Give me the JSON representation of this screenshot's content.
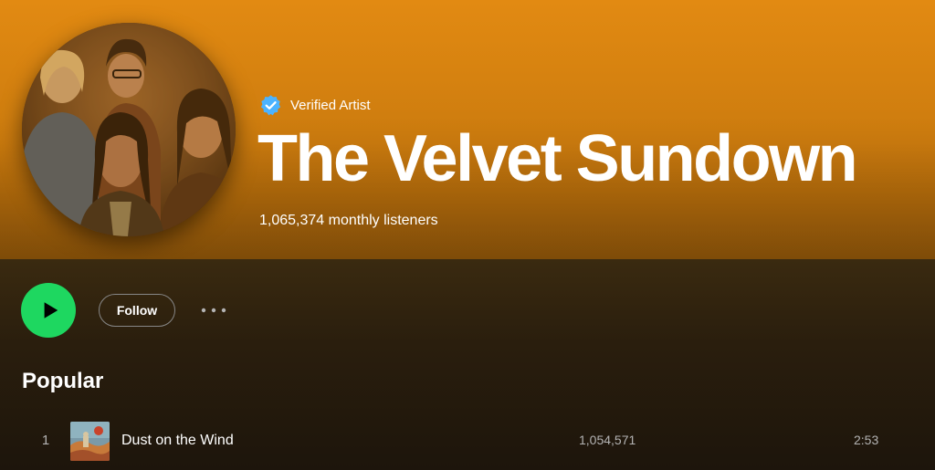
{
  "artist": {
    "verified_label": "Verified Artist",
    "name": "The Velvet Sundown",
    "monthly_listeners": "1,065,374 monthly listeners"
  },
  "controls": {
    "play_icon": "play-icon",
    "follow_label": "Follow",
    "more_icon": "more-horizontal-icon"
  },
  "popular": {
    "title": "Popular",
    "tracks": [
      {
        "number": "1",
        "title": "Dust on the Wind",
        "plays": "1,054,571",
        "duration": "2:53"
      }
    ]
  },
  "colors": {
    "header_accent": "#e28a12",
    "play_green": "#1ed760",
    "verified_blue": "#4cb3ff",
    "muted_text": "#b3b3b3"
  }
}
